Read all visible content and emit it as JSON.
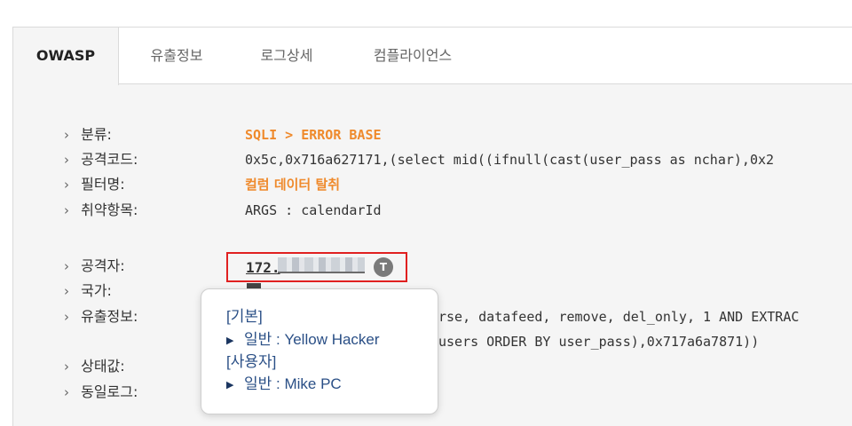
{
  "tabs": [
    {
      "label": "OWASP",
      "active": true
    },
    {
      "label": "유출정보",
      "active": false
    },
    {
      "label": "로그상세",
      "active": false
    },
    {
      "label": "컴플라이언스",
      "active": false
    }
  ],
  "fields": {
    "category": {
      "label": "분류:",
      "value": "SQLI > ERROR BASE"
    },
    "attack_code": {
      "label": "공격코드:",
      "value": "0x5c,0x716a627171,(select mid((ifnull(cast(user_pass as nchar),0x2"
    },
    "filter_name": {
      "label": "필터명:",
      "value": "컬럼 데이터 탈취"
    },
    "vuln_item": {
      "label": "취약항목:",
      "value": "ARGS : calendarId"
    },
    "attacker": {
      "label": "공격자:",
      "value": "172."
    },
    "country": {
      "label": "국가:"
    },
    "leak_info": {
      "label": "유출정보:",
      "value_line1": "rse, datafeed, remove, del_only, 1 AND EXTRAC",
      "value_line2": "users ORDER BY user_pass),0x717a6a7871))"
    },
    "status": {
      "label": "상태값:"
    },
    "same_log": {
      "label": "동일로그:"
    }
  },
  "attacker_badge": "T",
  "popover": {
    "section1": "[기본]",
    "item1": "일반 : Yellow Hacker",
    "section2": "[사용자]",
    "item2": "일반 : Mike PC"
  },
  "icons": {
    "chevron": "chevron-right-icon",
    "popover_item": "triangle-right-icon",
    "flag": "flag-icon"
  },
  "colors": {
    "accent": "#ef8a2c",
    "highlight_border": "#e02020",
    "popover_text": "#2a4f86"
  }
}
